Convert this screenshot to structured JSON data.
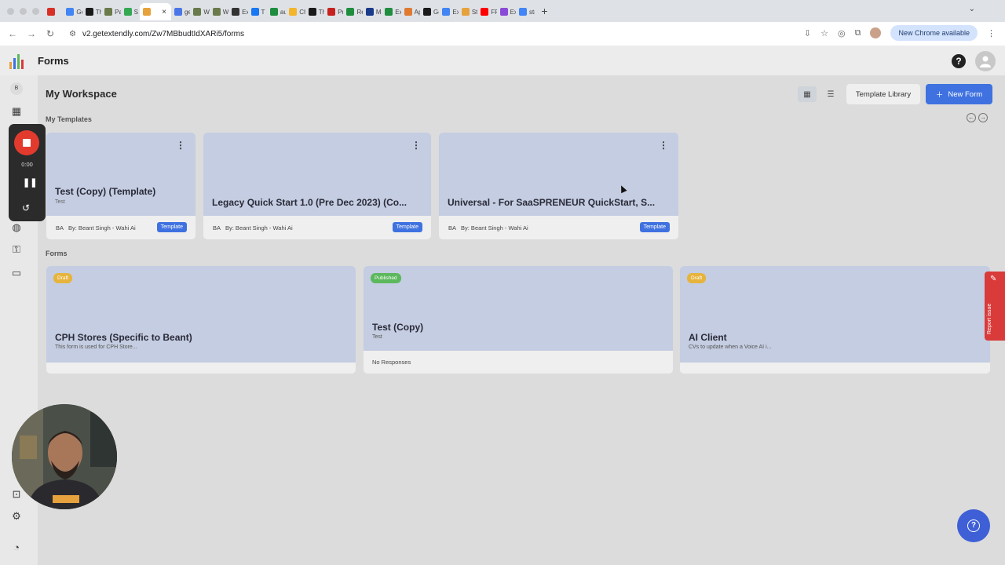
{
  "browser": {
    "tabs": [
      {
        "label": "",
        "icon": "gmail-icon",
        "color": "#d93025"
      },
      {
        "label": "Goo",
        "icon": "google-icon",
        "color": "#4285f4"
      },
      {
        "label": "The",
        "icon": "site-icon",
        "color": "#1a1a1a"
      },
      {
        "label": "Pay",
        "icon": "site-icon",
        "color": "#6a7a4a"
      },
      {
        "label": "S",
        "icon": "drive-icon",
        "color": "#34a853"
      },
      {
        "label": "",
        "icon": "extendly-icon",
        "color": "#e6a23c",
        "active": true
      },
      {
        "label": "getc",
        "icon": "site-icon",
        "color": "#4a76e8"
      },
      {
        "label": "Wah",
        "icon": "site-icon",
        "color": "#6a7a4a"
      },
      {
        "label": "Wah",
        "icon": "site-icon",
        "color": "#6a7a4a"
      },
      {
        "label": "Exte",
        "icon": "site-icon",
        "color": "#333"
      },
      {
        "label": "T",
        "icon": "facebook-icon",
        "color": "#1877f2"
      },
      {
        "label": "auth",
        "icon": "site-icon",
        "color": "#1e8e3e"
      },
      {
        "label": "Chu",
        "icon": "site-icon",
        "color": "#f2b52c"
      },
      {
        "label": "The",
        "icon": "site-icon",
        "color": "#1a1a1a"
      },
      {
        "label": "Pro",
        "icon": "site-icon",
        "color": "#c5221f"
      },
      {
        "label": "Rev",
        "icon": "sheets-icon",
        "color": "#1e8e3e"
      },
      {
        "label": "Mar",
        "icon": "site-icon",
        "color": "#1a3a8a"
      },
      {
        "label": "Exte",
        "icon": "sheets-icon",
        "color": "#1e8e3e"
      },
      {
        "label": "App",
        "icon": "site-icon",
        "color": "#e07a30"
      },
      {
        "label": "GoH",
        "icon": "site-icon",
        "color": "#1a1a1a"
      },
      {
        "label": "Exte",
        "icon": "docs-icon",
        "color": "#4285f4"
      },
      {
        "label": "Step",
        "icon": "extendly-icon",
        "color": "#e6a23c"
      },
      {
        "label": "FRE",
        "icon": "youtube-icon",
        "color": "#ff0000"
      },
      {
        "label": "Exte",
        "icon": "site-icon",
        "color": "#8a4ad8"
      },
      {
        "label": "stra",
        "icon": "google-icon",
        "color": "#4285f4"
      }
    ],
    "active_tab_close": "×",
    "new_tab": "+",
    "url": "v2.getextendly.com/Zw7MBbudtIdXARi5/forms",
    "new_chrome_label": "New Chrome available"
  },
  "app": {
    "title": "Forms",
    "workspace_title": "My Workspace",
    "template_library_label": "Template Library",
    "new_form_label": "New Form",
    "my_templates_label": "My Templates",
    "forms_label": "Forms",
    "sidebar_badge": "B",
    "templates": [
      {
        "title": "Test (Copy) (Template)",
        "subtitle": "Test",
        "author_initials": "BA",
        "author": "By: Beant Singh - Wahi Ai",
        "tag": "Template"
      },
      {
        "title": "Legacy Quick Start 1.0 (Pre Dec 2023) (Co...",
        "subtitle": "",
        "author_initials": "BA",
        "author": "By: Beant Singh - Wahi Ai",
        "tag": "Template"
      },
      {
        "title": "Universal - For SaaSPRENEUR QuickStart, S...",
        "subtitle": "",
        "author_initials": "BA",
        "author": "By: Beant Singh - Wahi Ai",
        "tag": "Template"
      }
    ],
    "forms": [
      {
        "status": "Draft",
        "status_color": "#e6b43c",
        "title": "CPH Stores (Specific to Beant)",
        "subtitle": "This form is used for CPH Store...",
        "responses": ""
      },
      {
        "status": "Published",
        "status_color": "#5cb85c",
        "title": "Test (Copy)",
        "subtitle": "Test",
        "responses": "No Responses"
      },
      {
        "status": "Draft",
        "status_color": "#e6b43c",
        "title": "AI Client",
        "subtitle": "CVs to update when a Voice AI i...",
        "responses": ""
      }
    ],
    "report_issue_label": "Report issue"
  },
  "recorder": {
    "time": "0:00"
  },
  "colors": {
    "accent": "#3f72e0",
    "card_header": "#c4cde1",
    "record_red": "#e23b2e"
  }
}
